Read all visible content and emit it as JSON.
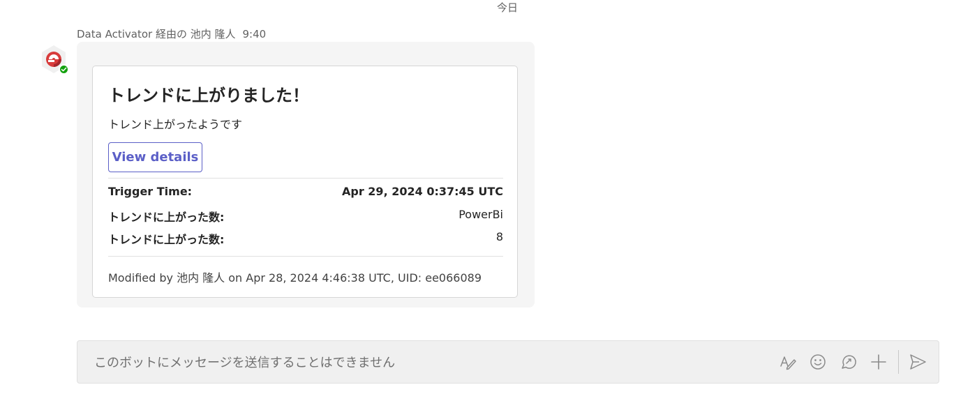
{
  "date_divider": "今日",
  "message": {
    "sender": "Data Activator 経由の 池内 隆人",
    "time": "9:40"
  },
  "card": {
    "title": "トレンドに上がりました！",
    "subtitle": "トレンド上がったようです",
    "action_label": "View details",
    "facts": [
      {
        "key": "Trigger Time:",
        "value": "Apr 29, 2024 0:37:45 UTC"
      },
      {
        "key": "トレンドに上がった数:",
        "value": "PowerBi"
      },
      {
        "key": "トレンドに上がった数:",
        "value": "8"
      }
    ],
    "footer": "Modified by 池内 隆人 on Apr 28, 2024 4:46:38 UTC, UID: ee066089"
  },
  "compose": {
    "placeholder": "このボットにメッセージを送信することはできません"
  },
  "icons": {
    "format": "format-icon",
    "emoji": "emoji-icon",
    "loop": "loop-icon",
    "attach": "plus-icon",
    "send": "send-icon"
  },
  "colors": {
    "accent": "#5b5fc7",
    "presence": "#13a10e",
    "bubble": "#f5f5f5",
    "logo": "#d83b3b"
  }
}
